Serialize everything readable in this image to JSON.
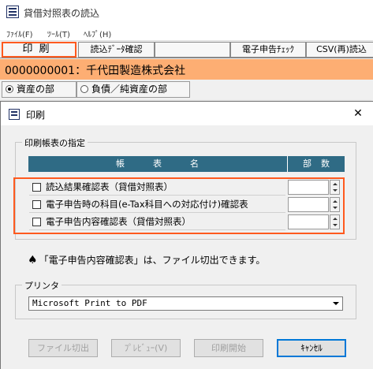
{
  "app": {
    "title": "貸借対照表の読込",
    "menu": [
      "ﾌｧｲﾙ(F)",
      "ﾂｰﾙ(T)",
      "ﾍﾙﾌﾟ(H)"
    ]
  },
  "toolbar": {
    "print": "印刷",
    "read_confirm": "読込ﾃﾞｰﾀ確認",
    "e_check": "電子申告ﾁｪｯｸ",
    "csv": "CSV(再)読込"
  },
  "company": {
    "text": "0000000001：千代田製造株式会社"
  },
  "sections": {
    "assets": "資産の部",
    "liabilities": "負債／純資産の部"
  },
  "dialog": {
    "title": "印刷",
    "group_title": "印刷帳表の指定",
    "col_name": "帳表名",
    "col_count": "部数",
    "rows": [
      {
        "label": "読込結果確認表（貸借対照表）",
        "checked": false,
        "count": ""
      },
      {
        "label": "電子申告時の科目(e-Tax科目への対応付け)確認表",
        "checked": false,
        "count": ""
      },
      {
        "label": "電子申告内容確認表（貸借対照表）",
        "checked": false,
        "count": ""
      }
    ],
    "note": "「電子申告内容確認表」は、ファイル切出できます。",
    "printer_label": "プリンタ",
    "printer_value": "Microsoft Print to PDF",
    "buttons": {
      "file_export": "ファイル切出",
      "preview": "ﾌﾟﾚﾋﾞｭｰ(V)",
      "print_start": "印刷開始",
      "cancel": "ｷｬﾝｾﾙ"
    }
  },
  "colors": {
    "accent": "#ff5a1f",
    "company_bar": "#fdae73",
    "table_header": "#2f6b85"
  }
}
